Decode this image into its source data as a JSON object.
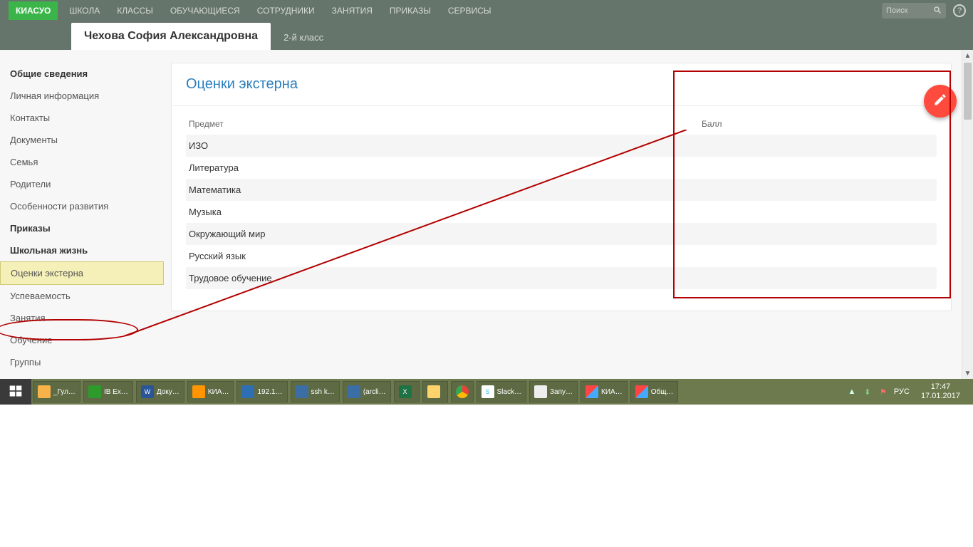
{
  "topbar": {
    "logo": "КИАСУО",
    "nav": [
      "ШКОЛА",
      "КЛАССЫ",
      "ОБУЧАЮЩИЕСЯ",
      "СОТРУДНИКИ",
      "ЗАНЯТИЯ",
      "ПРИКАЗЫ",
      "СЕРВИСЫ"
    ],
    "search_placeholder": "Поиск"
  },
  "subheader": {
    "student": "Чехова София Александровна",
    "class": "2-й класс"
  },
  "sidebar": {
    "sec1_title": "Общие сведения",
    "sec1_items": [
      "Личная информация",
      "Контакты",
      "Документы",
      "Семья",
      "Родители",
      "Особенности развития"
    ],
    "sec2_title": "Приказы",
    "sec3_title": "Школьная жизнь",
    "sec3_items": [
      "Оценки экстерна",
      "Успеваемость",
      "Занятия",
      "Обучение",
      "Группы"
    ]
  },
  "card": {
    "title": "Оценки экстерна",
    "col_subject": "Предмет",
    "col_score": "Балл",
    "subjects": [
      "ИЗО",
      "Литература",
      "Математика",
      "Музыка",
      "Окружающий мир",
      "Русский язык",
      "Трудовое обучение"
    ]
  },
  "taskbar": {
    "items": [
      "_Гул…",
      "IB Ex…",
      "Доку…",
      "КИА…",
      "192.1…",
      "ssh k…",
      "(arcli…",
      "",
      "",
      "Slack…",
      "Запу…",
      "КИА…",
      "Общ…"
    ],
    "lang": "РУС",
    "time": "17:47",
    "date": "17.01.2017"
  }
}
